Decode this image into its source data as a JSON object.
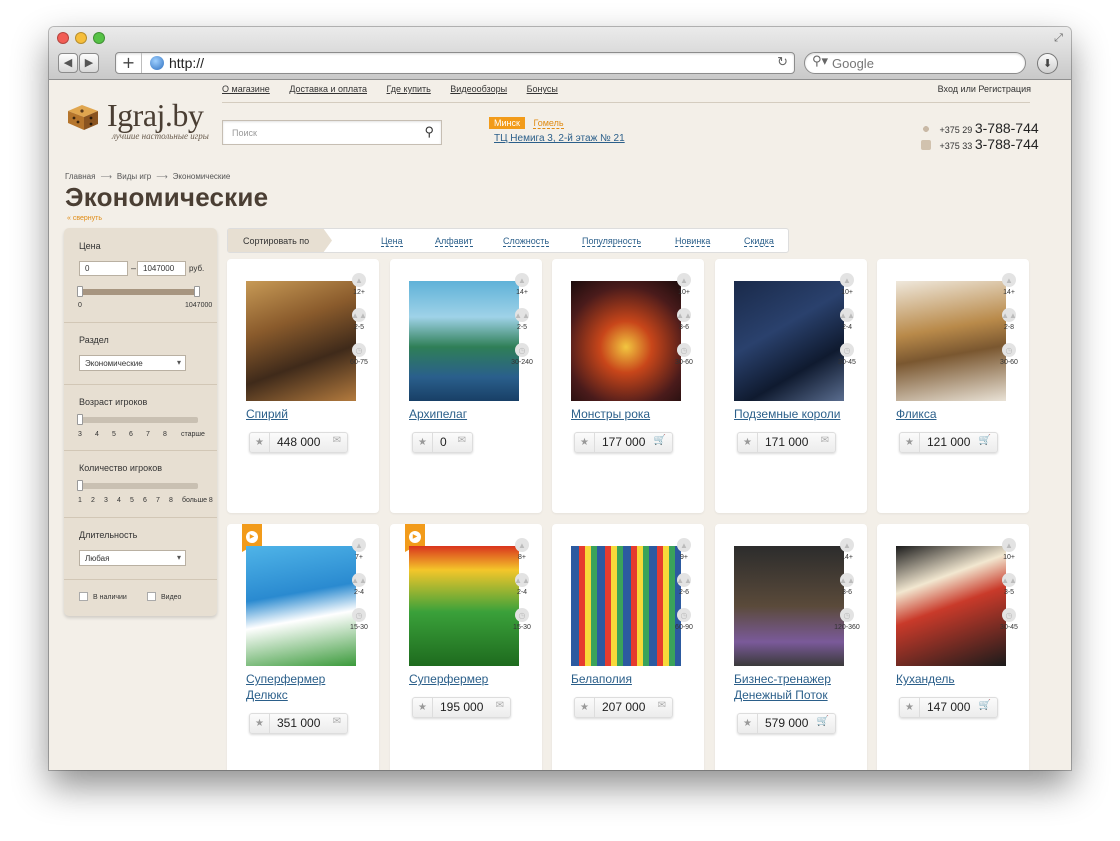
{
  "browser": {
    "url": "http://",
    "search_placeholder": "Google"
  },
  "topnav": [
    "О магазине",
    "Доставка и оплата",
    "Где купить",
    "Видеообзоры",
    "Бонусы"
  ],
  "auth": {
    "login": "Вход",
    "or": "или",
    "register": "Регистрация"
  },
  "logo": {
    "name": "Igraj.by",
    "tagline": "лучшие настольные игры"
  },
  "site_search": {
    "placeholder": "Поиск"
  },
  "cities": {
    "active": "Минск",
    "other": "Гомель",
    "address": "ТЦ Немига 3, 2-й этаж № 21"
  },
  "phones": [
    {
      "prefix": "+375 29",
      "number": "3-788-744"
    },
    {
      "prefix": "+375 33",
      "number": "3-788-744"
    }
  ],
  "breadcrumbs": [
    "Главная",
    "Виды игр",
    "Экономические"
  ],
  "page_title": "Экономические",
  "collapse_label": "« свернуть",
  "filter": {
    "price": {
      "label": "Цена",
      "min": "0",
      "max": "1047000",
      "currency": "руб.",
      "tick_min": "0",
      "tick_max": "1047000"
    },
    "section": {
      "label": "Раздел",
      "value": "Экономические"
    },
    "age": {
      "label": "Возраст игроков",
      "ticks": [
        "3",
        "4",
        "5",
        "6",
        "7",
        "8",
        "старше"
      ]
    },
    "players": {
      "label": "Количество игроков",
      "ticks": [
        "1",
        "2",
        "3",
        "4",
        "5",
        "6",
        "7",
        "8",
        "больше 8"
      ]
    },
    "duration": {
      "label": "Длительность",
      "value": "Любая"
    },
    "in_stock": "В наличии",
    "video": "Видео"
  },
  "sort": {
    "label": "Сортировать по",
    "options": [
      "Цена",
      "Алфавит",
      "Сложность",
      "Популярность",
      "Новинка",
      "Скидка"
    ]
  },
  "products": [
    {
      "name": "Спирий",
      "age": "12+",
      "players": "2-5",
      "time": "60-75",
      "price": "448 000",
      "action": "mail",
      "video": false
    },
    {
      "name": "Архипелаг",
      "age": "14+",
      "players": "2-5",
      "time": "30-240",
      "price": "0",
      "action": "mail",
      "video": false
    },
    {
      "name": "Монстры рока",
      "age": "10+",
      "players": "3-6",
      "time": "30-60",
      "price": "177 000",
      "action": "cart",
      "video": false
    },
    {
      "name": "Подземные короли",
      "age": "10+",
      "players": "2-4",
      "time": "30-45",
      "price": "171 000",
      "action": "mail",
      "video": false
    },
    {
      "name": "Фликса",
      "age": "14+",
      "players": "2-8",
      "time": "30-60",
      "price": "121 000",
      "action": "cart",
      "video": false
    },
    {
      "name": "Суперфермер Делюкс",
      "age": "7+",
      "players": "2-4",
      "time": "15-30",
      "price": "351 000",
      "action": "mail",
      "video": true
    },
    {
      "name": "Суперфермер",
      "age": "8+",
      "players": "2-4",
      "time": "15-30",
      "price": "195 000",
      "action": "mail",
      "video": true
    },
    {
      "name": "Белаполия",
      "age": "9+",
      "players": "2-6",
      "time": "60-90",
      "price": "207 000",
      "action": "mail",
      "video": false
    },
    {
      "name": "Бизнес-тренажер Денежный Поток",
      "age": "14+",
      "players": "3-6",
      "time": "120-360",
      "price": "579 000",
      "action": "cart",
      "video": false
    },
    {
      "name": "Кухандель",
      "age": "10+",
      "players": "3-5",
      "time": "30-45",
      "price": "147 000",
      "action": "cart",
      "video": false
    }
  ],
  "icons": {
    "star": "star-icon",
    "mail": "mail-icon",
    "cart": "cart-icon",
    "age": "person-icon",
    "players": "group-icon",
    "time": "clock-icon",
    "video": "play-icon"
  },
  "colors": {
    "accent": "#f29b1a",
    "link": "#2b5f8a",
    "background": "#f3efe8",
    "filter_panel": "#e7dfd2"
  }
}
